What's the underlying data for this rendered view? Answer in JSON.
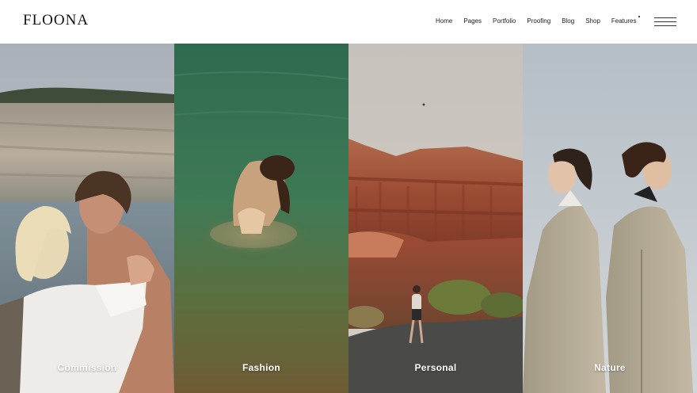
{
  "brand": {
    "logo": "FLOONA"
  },
  "nav": {
    "items": [
      {
        "label": "Home"
      },
      {
        "label": "Pages"
      },
      {
        "label": "Portfolio"
      },
      {
        "label": "Proofing"
      },
      {
        "label": "Blog"
      },
      {
        "label": "Shop"
      },
      {
        "label": "Features"
      }
    ]
  },
  "categories": [
    {
      "label": "Commission",
      "image": "couple embracing by quarry lake"
    },
    {
      "label": "Fashion",
      "image": "woman sitting in green water"
    },
    {
      "label": "Personal",
      "image": "person walking on road near red canyon"
    },
    {
      "label": "Nature",
      "image": "two women in trench coats against sky"
    }
  ]
}
